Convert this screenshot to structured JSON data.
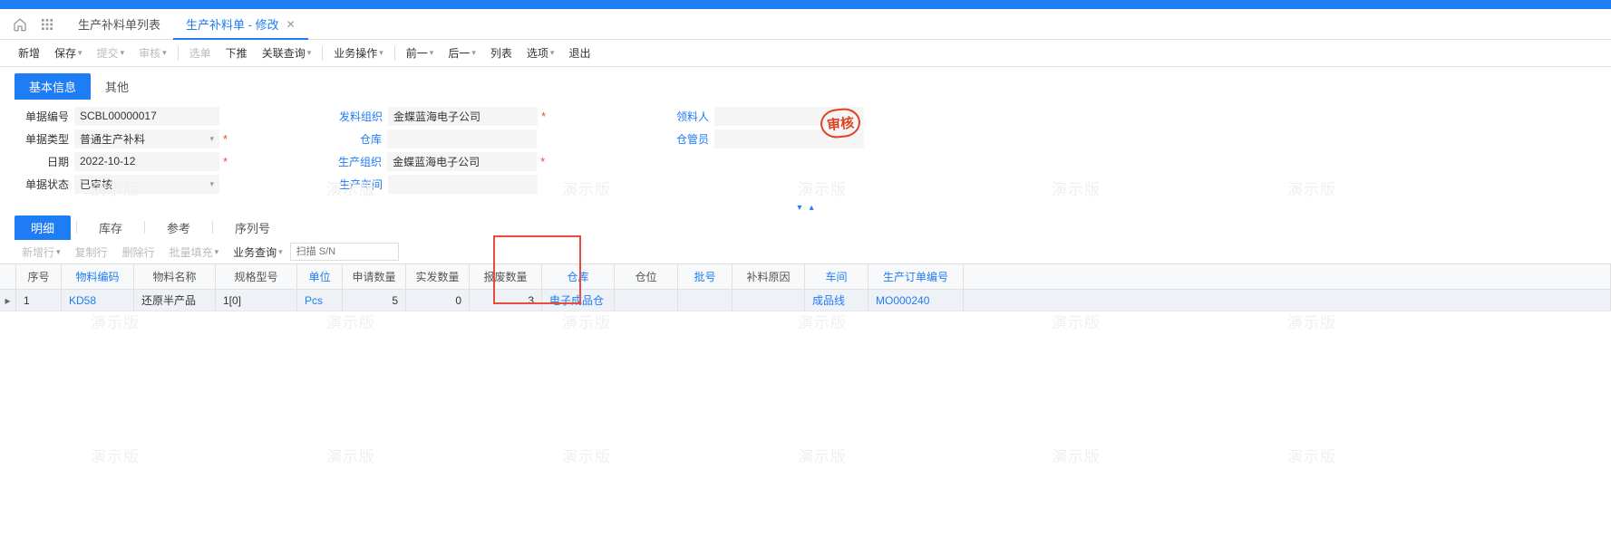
{
  "breadcrumbs": {
    "tab1": "生产补料单列表",
    "tab2": "生产补料单 - 修改"
  },
  "toolbar": {
    "new": "新增",
    "save": "保存",
    "submit": "提交",
    "audit": "审核",
    "select": "选单",
    "push": "下推",
    "relquery": "关联查询",
    "bizop": "业务操作",
    "prev": "前一",
    "next": "后一",
    "list": "列表",
    "option": "选项",
    "exit": "退出"
  },
  "section_tabs": {
    "basic": "基本信息",
    "other": "其他"
  },
  "form": {
    "labels": {
      "billno": "单据编号",
      "billtype": "单据类型",
      "date": "日期",
      "status": "单据状态",
      "sendorg": "发料组织",
      "warehouse": "仓库",
      "prodorg": "生产组织",
      "workshop": "生产车间",
      "picker": "领料人",
      "keeper": "仓管员"
    },
    "values": {
      "billno": "SCBL00000017",
      "billtype": "普通生产补料",
      "date": "2022-10-12",
      "status": "已审核",
      "sendorg": "金蝶蓝海电子公司",
      "warehouse": "",
      "prodorg": "金蝶蓝海电子公司",
      "workshop": "",
      "picker": "",
      "keeper": ""
    }
  },
  "stamp": "审核",
  "detail_tabs": {
    "detail": "明细",
    "stock": "库存",
    "ref": "参考",
    "serial": "序列号"
  },
  "detail_toolbar": {
    "addrow": "新增行",
    "copyrow": "复制行",
    "delrow": "删除行",
    "batchfill": "批量填充",
    "bizquery": "业务查询",
    "scan_ph": "扫描 S/N"
  },
  "grid": {
    "headers": {
      "seq": "序号",
      "code": "物料编码",
      "name": "物料名称",
      "spec": "规格型号",
      "unit": "单位",
      "reqqty": "申请数量",
      "actqty": "实发数量",
      "scrapqty": "报废数量",
      "warehouse": "仓库",
      "loc": "仓位",
      "batch": "批号",
      "reason": "补料原因",
      "workshop": "车间",
      "orderno": "生产订单编号"
    },
    "row": {
      "seq": "1",
      "code": "KD58",
      "name": "还原半产品",
      "spec": "1[0]",
      "unit": "Pcs",
      "reqqty": "5",
      "actqty": "0",
      "scrapqty": "3",
      "warehouse": "电子成品仓",
      "loc": "",
      "batch": "",
      "reason": "",
      "workshop": "成品线",
      "orderno": "MO000240"
    }
  },
  "watermark": "演示版"
}
